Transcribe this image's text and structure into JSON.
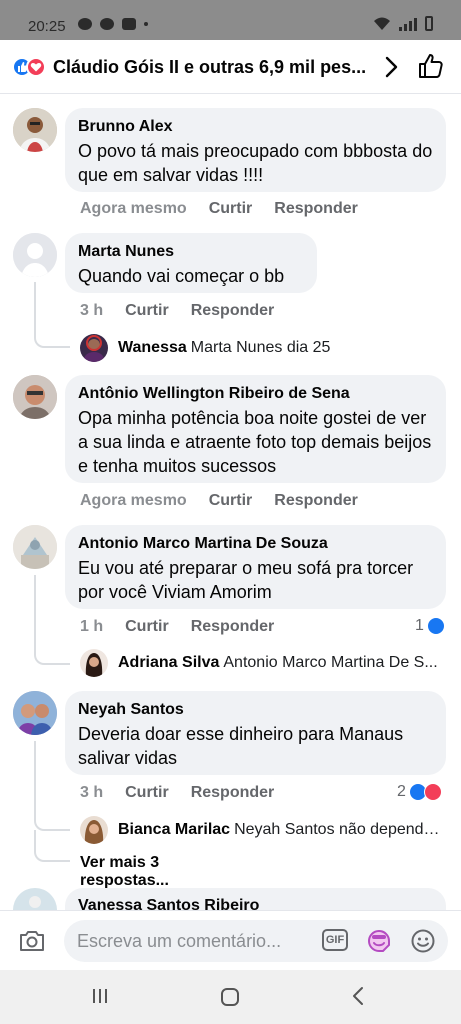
{
  "status_bar": {
    "time": "20:25"
  },
  "header": {
    "title": "Cláudio Góis II e outras 6,9 mil pes...",
    "reaction_icons": [
      "like-icon",
      "love-icon"
    ]
  },
  "comments": [
    {
      "author": "Brunno Alex",
      "text": "O povo tá mais preocupado com bbbosta do que em salvar vidas !!!!",
      "time": "Agora mesmo",
      "like_label": "Curtir",
      "reply_label": "Responder"
    },
    {
      "author": "Marta Nunes",
      "text": "Quando vai começar o bb",
      "time": "3 h",
      "like_label": "Curtir",
      "reply_label": "Responder",
      "reply_preview": {
        "author": "Wanessa",
        "text": "Marta Nunes dia 25"
      }
    },
    {
      "author": "Antônio Wellington Ribeiro de Sena",
      "text": "Opa minha potência boa noite gostei de ver a sua linda e atraente foto top demais beijos e tenha muitos sucessos",
      "time": "Agora mesmo",
      "like_label": "Curtir",
      "reply_label": "Responder"
    },
    {
      "author": "Antonio Marco Martina De Souza",
      "text": "Eu vou até preparar o meu sofá pra torcer por você Viviam Amorim",
      "time": "1 h",
      "like_label": "Curtir",
      "reply_label": "Responder",
      "reaction_count": "1",
      "reply_preview": {
        "author": "Adriana Silva",
        "text": "Antonio Marco Martina De S..."
      }
    },
    {
      "author": "Neyah Santos",
      "text": "Deveria doar esse dinheiro para Manaus salivar vidas",
      "time": "3 h",
      "like_label": "Curtir",
      "reply_label": "Responder",
      "reaction_count": "2",
      "reply_preview": {
        "author": "Bianca Marilac",
        "text": "Neyah Santos não depende..."
      },
      "more_replies": "Ver mais 3 respostas..."
    },
    {
      "author": "Vanessa Santos Ribeiro"
    }
  ],
  "composer": {
    "placeholder": "Escreva um comentário...",
    "gif_label": "GIF"
  },
  "colors": {
    "brand_blue": "#1877f2",
    "love_red": "#f33e58",
    "bubble_gray": "#f0f2f5",
    "meta_gray": "#65676b"
  }
}
